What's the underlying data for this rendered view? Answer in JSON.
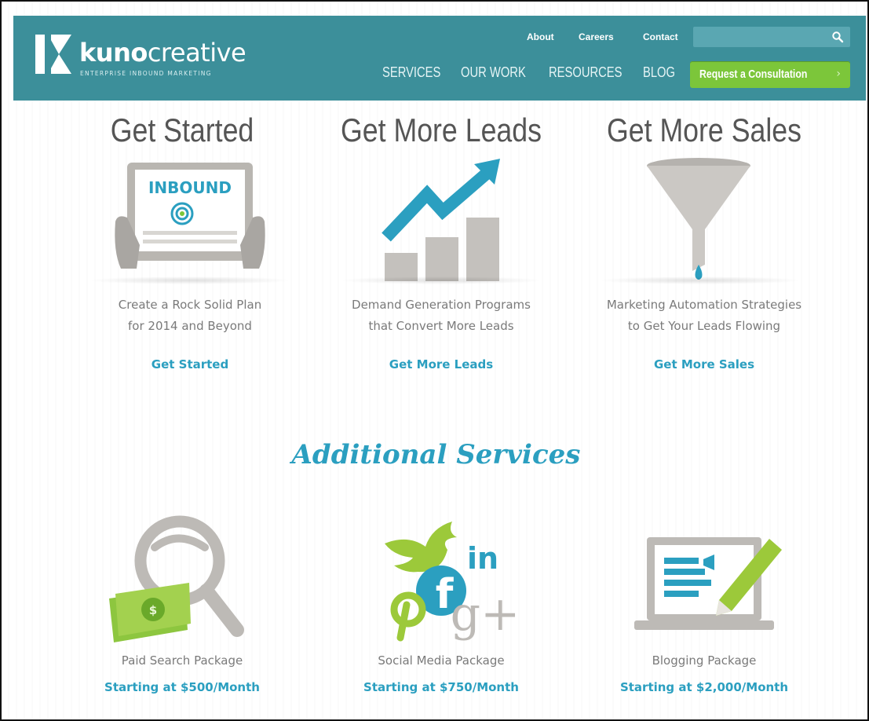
{
  "brand": {
    "name_bold": "kuno",
    "name_light": "creative",
    "tagline": "ENTERPRISE INBOUND MARKETING",
    "header_color": "#3c8f9a",
    "accent_green": "#7cc63a",
    "link_blue": "#2b9fc0"
  },
  "header": {
    "util_links": [
      "About",
      "Careers",
      "Contact"
    ],
    "search": {
      "placeholder": "",
      "icon": "search-icon"
    },
    "nav": [
      "SERVICES",
      "OUR WORK",
      "RESOURCES",
      "BLOG"
    ],
    "cta": "Request a Consultation"
  },
  "features": [
    {
      "title": "Get Started",
      "desc_line1": "Create a Rock Solid Plan",
      "desc_line2": "for 2014 and Beyond",
      "link": "Get Started",
      "icon": "tablet-icon",
      "tablet_text": "INBOUND"
    },
    {
      "title": "Get More Leads",
      "desc_line1": "Demand Generation Programs",
      "desc_line2": "that Convert More Leads",
      "link": "Get More Leads",
      "icon": "growth-chart-icon"
    },
    {
      "title": "Get More Sales",
      "desc_line1": "Marketing Automation Strategies",
      "desc_line2": "to Get Your Leads Flowing",
      "link": "Get More Sales",
      "icon": "funnel-icon"
    }
  ],
  "additional": {
    "heading": "Additional Services",
    "services": [
      {
        "name": "Paid Search Package",
        "price": "Starting at $500/Month",
        "icon": "magnifier-money-icon"
      },
      {
        "name": "Social Media Package",
        "price": "Starting at $750/Month",
        "icon": "social-icons-icon",
        "social_labels": [
          "in",
          "f",
          "g+"
        ]
      },
      {
        "name": "Blogging Package",
        "price": "Starting at $2,000/Month",
        "icon": "laptop-pencil-icon"
      }
    ]
  }
}
